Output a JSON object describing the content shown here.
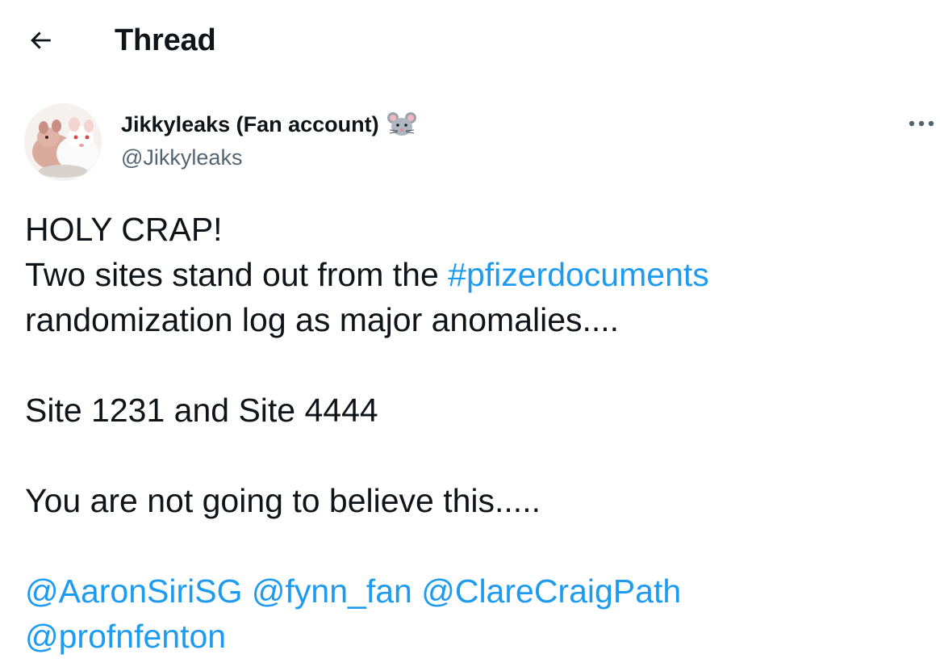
{
  "header": {
    "title": "Thread",
    "back_icon": "arrow-left-icon"
  },
  "author": {
    "name": "Jikkyleaks (Fan account)",
    "name_emoji": "mouse-face-icon",
    "handle": "@Jikkyleaks",
    "avatar": "rats-avatar-image"
  },
  "more_icon": "more-horizontal-icon",
  "tweet": {
    "line1": "HOLY CRAP!",
    "line2_text": "Two sites stand out from the ",
    "hashtag": "#pfizerdocuments",
    "line3": "randomization log as major anomalies....",
    "line4": "Site 1231 and Site 4444",
    "line5": "You are not going to believe this.....",
    "mentions": [
      "@AaronSiriSG",
      "@fynn_fan",
      "@ClareCraigPath",
      "@profnfenton"
    ]
  },
  "colors": {
    "link": "#1d9bf0",
    "text": "#0f1419",
    "secondary": "#536471"
  }
}
